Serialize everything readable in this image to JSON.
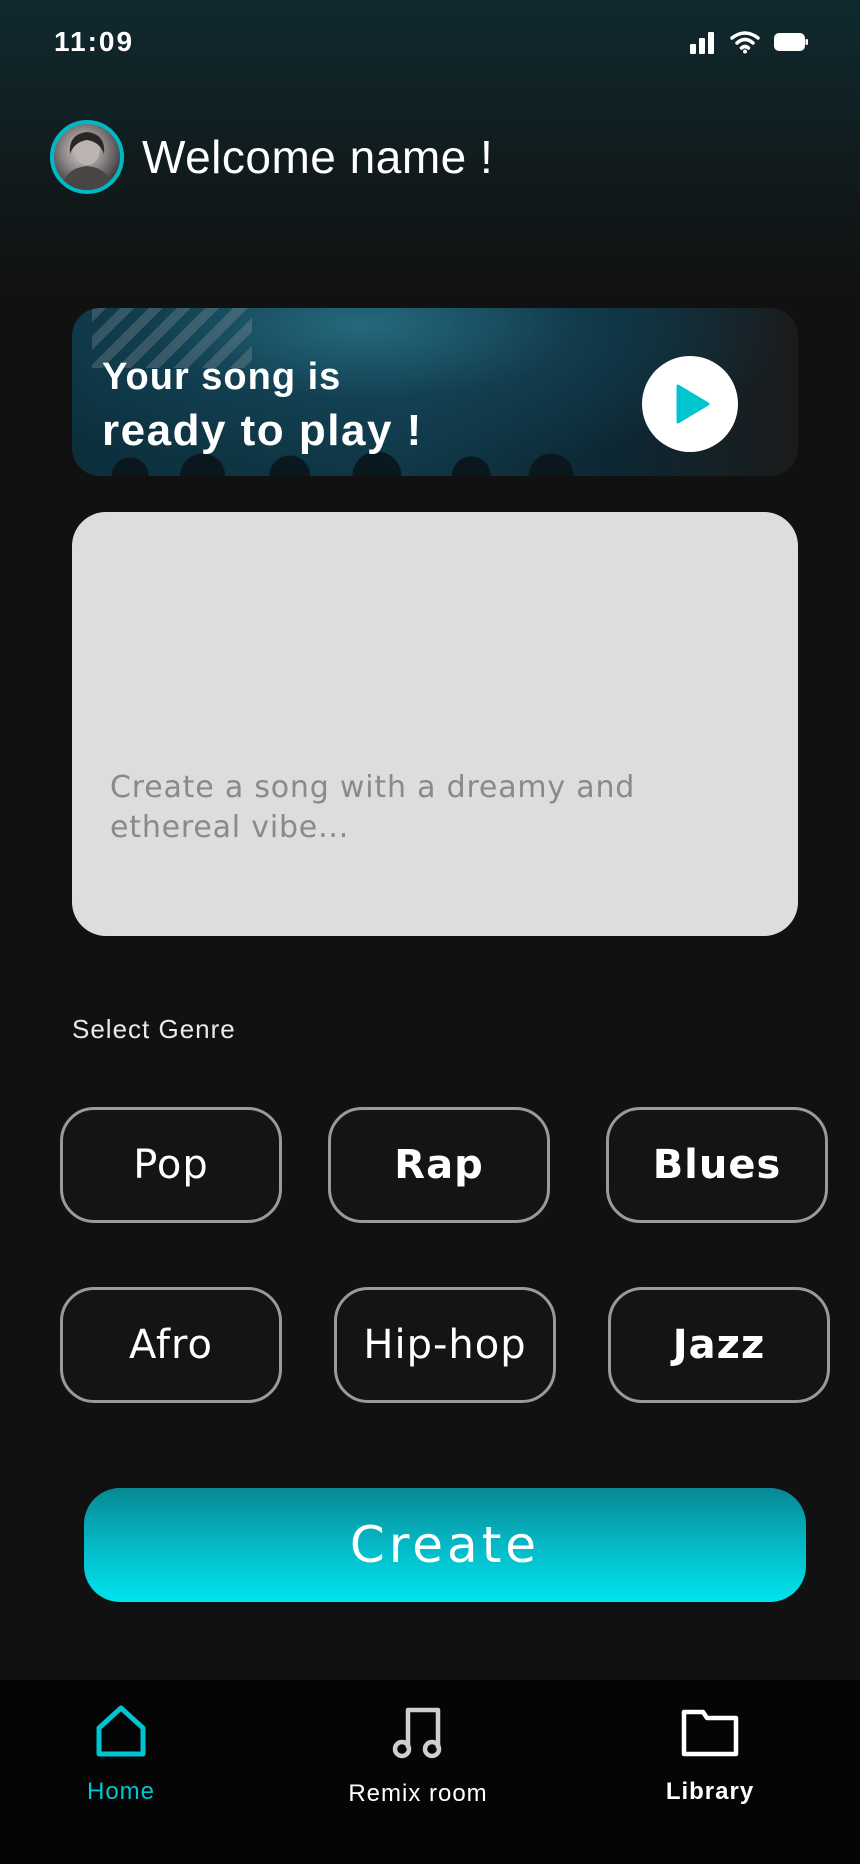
{
  "status_bar": {
    "time": "11:09"
  },
  "header": {
    "welcome": "Welcome name !"
  },
  "banner": {
    "line1": "Your song is",
    "line2": "ready to play !"
  },
  "prompt": {
    "placeholder": "Create a song with a dreamy and ethereal vibe..."
  },
  "genre": {
    "label": "Select Genre",
    "options": [
      "Pop",
      "Rap",
      "Blues",
      "Afro",
      "Hip-hop",
      "Jazz"
    ]
  },
  "create": {
    "label": "Create"
  },
  "tabs": [
    {
      "label": "Home",
      "icon": "home-icon",
      "active": true
    },
    {
      "label": "Remix room",
      "icon": "music-note-icon",
      "active": false
    },
    {
      "label": "Library",
      "icon": "folder-icon",
      "active": false
    }
  ],
  "colors": {
    "accent": "#00c4d0",
    "background": "#111111",
    "prompt_bg": "#dddddd"
  }
}
